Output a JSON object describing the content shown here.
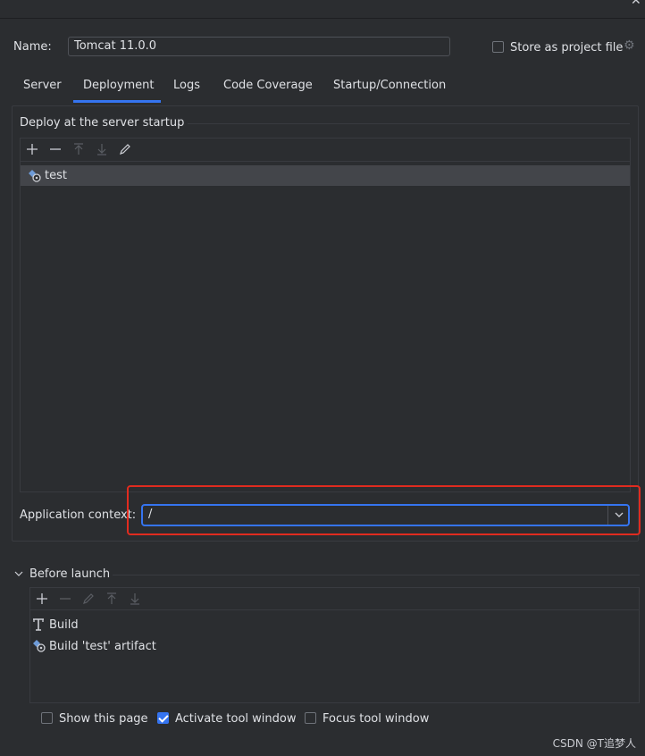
{
  "name_field": {
    "label": "Name:",
    "value": "Tomcat 11.0.0"
  },
  "store_as_project_file": {
    "label": "Store as project file",
    "checked": false
  },
  "tabs": [
    {
      "label": "Server",
      "active": false
    },
    {
      "label": "Deployment",
      "active": true
    },
    {
      "label": "Logs",
      "active": false
    },
    {
      "label": "Code Coverage",
      "active": false
    },
    {
      "label": "Startup/Connection",
      "active": false
    }
  ],
  "deploy_section": {
    "title": "Deploy at the server startup",
    "toolbar_icons": [
      "add-icon",
      "remove-icon",
      "move-up-icon",
      "move-down-icon",
      "edit-icon"
    ],
    "items": [
      {
        "label": "test",
        "icon": "artifact-icon",
        "selected": true
      }
    ]
  },
  "application_context": {
    "label": "Application context:",
    "value": "/"
  },
  "before_launch": {
    "title": "Before launch",
    "toolbar_icons": [
      "add-icon",
      "remove-icon",
      "edit-icon",
      "move-up-icon",
      "move-down-icon"
    ],
    "items": [
      {
        "label": "Build",
        "icon": "build-icon"
      },
      {
        "label": "Build 'test' artifact",
        "icon": "artifact-icon"
      }
    ]
  },
  "options": {
    "show_this_page": {
      "label": "Show this page",
      "checked": false
    },
    "activate_tool_window": {
      "label": "Activate tool window",
      "checked": true
    },
    "focus_tool_window": {
      "label": "Focus tool window",
      "checked": false
    }
  },
  "watermark": "CSDN @T追梦人",
  "colors": {
    "background": "#2b2d30",
    "accent": "#3574f0",
    "highlight_box": "#e02b1f",
    "selection": "#43454a"
  }
}
